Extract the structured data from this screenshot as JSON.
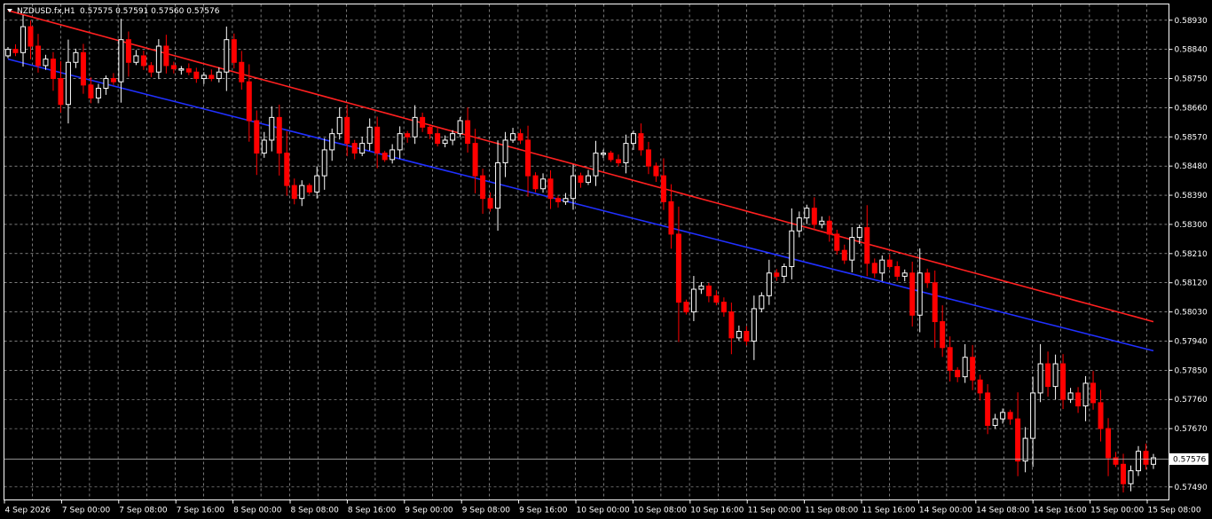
{
  "header": {
    "symbol_tf": "NZDUSD.fx,H1",
    "ohlc": "0.57575 0.57591 0.57560 0.57576"
  },
  "colors": {
    "background": "#000000",
    "grid": "#c8c8c8",
    "frame": "#ffffff",
    "bull_fill": "#000000",
    "bull_stroke": "#ffffff",
    "bear_fill": "#ff0000",
    "ma_slow": "#ff2020",
    "ma_fast": "#2030ff",
    "current_line": "#c0c0c0"
  },
  "chart_data": {
    "type": "candlestick",
    "symbol": "NZDUSD.fx",
    "timeframe": "H1",
    "ylim": [
      0.5745,
      0.5898
    ],
    "y_ticks": [
      "0.58930",
      "0.58840",
      "0.58750",
      "0.58660",
      "0.58570",
      "0.58480",
      "0.58390",
      "0.58300",
      "0.58210",
      "0.58120",
      "0.58030",
      "0.57940",
      "0.57850",
      "0.57760",
      "0.57670",
      "0.57490"
    ],
    "x_ticks": [
      "4 Sep 2026",
      "7 Sep 00:00",
      "7 Sep 08:00",
      "7 Sep 16:00",
      "8 Sep 00:00",
      "8 Sep 08:00",
      "8 Sep 16:00",
      "9 Sep 00:00",
      "9 Sep 08:00",
      "9 Sep 16:00",
      "10 Sep 00:00",
      "10 Sep 08:00",
      "10 Sep 16:00",
      "11 Sep 00:00",
      "11 Sep 08:00",
      "11 Sep 16:00",
      "14 Sep 00:00",
      "14 Sep 08:00",
      "14 Sep 16:00",
      "15 Sep 00:00",
      "15 Sep 08:00"
    ],
    "current_price": "0.57576",
    "close": [
      0.5884,
      0.5883,
      0.5891,
      0.5885,
      0.5879,
      0.5881,
      0.5875,
      0.5867,
      0.588,
      0.5883,
      0.5873,
      0.5869,
      0.5872,
      0.5875,
      0.5874,
      0.5887,
      0.588,
      0.5882,
      0.5879,
      0.5877,
      0.5885,
      0.5879,
      0.5878,
      0.5878,
      0.5877,
      0.5875,
      0.5876,
      0.5875,
      0.5877,
      0.5887,
      0.588,
      0.5874,
      0.5862,
      0.5852,
      0.5856,
      0.5863,
      0.5852,
      0.5842,
      0.5838,
      0.5842,
      0.584,
      0.5845,
      0.5853,
      0.5858,
      0.5863,
      0.5855,
      0.5852,
      0.5855,
      0.586,
      0.5852,
      0.585,
      0.5853,
      0.5858,
      0.5857,
      0.5863,
      0.586,
      0.5858,
      0.5855,
      0.5856,
      0.5858,
      0.5862,
      0.5855,
      0.5845,
      0.5838,
      0.5835,
      0.5849,
      0.5856,
      0.5858,
      0.5856,
      0.5845,
      0.5841,
      0.5844,
      0.5838,
      0.5837,
      0.5838,
      0.5845,
      0.5843,
      0.5845,
      0.5852,
      0.5852,
      0.585,
      0.5849,
      0.5855,
      0.5858,
      0.5853,
      0.5848,
      0.5845,
      0.5837,
      0.5827,
      0.5806,
      0.5803,
      0.581,
      0.5811,
      0.5808,
      0.5806,
      0.5803,
      0.5795,
      0.5797,
      0.5794,
      0.5804,
      0.5808,
      0.5815,
      0.5814,
      0.5817,
      0.5828,
      0.5832,
      0.5835,
      0.583,
      0.5831,
      0.5827,
      0.5822,
      0.5819,
      0.5826,
      0.5829,
      0.5818,
      0.5815,
      0.5819,
      0.5817,
      0.5814,
      0.5815,
      0.5802,
      0.5815,
      0.5812,
      0.58,
      0.5792,
      0.5785,
      0.5783,
      0.5789,
      0.5782,
      0.5778,
      0.5768,
      0.577,
      0.5772,
      0.577,
      0.5757,
      0.5764,
      0.5778,
      0.5787,
      0.578,
      0.5787,
      0.5776,
      0.5778,
      0.5774,
      0.5781,
      0.5775,
      0.5767,
      0.5758,
      0.5756,
      0.575,
      0.5754,
      0.576,
      0.5756,
      0.5758
    ],
    "ma_red": [
      0.5896,
      0.58944,
      0.58928,
      0.58912,
      0.58896,
      0.5888,
      0.58864,
      0.58848,
      0.58832,
      0.58816,
      0.588,
      0.58784,
      0.58768,
      0.58752,
      0.58736,
      0.5872,
      0.58704,
      0.58688,
      0.58672,
      0.58656,
      0.5864,
      0.58624,
      0.58608,
      0.58592,
      0.58576,
      0.5856,
      0.58544,
      0.58528,
      0.58512,
      0.58496,
      0.5848,
      0.58464,
      0.58448,
      0.58432,
      0.58416,
      0.584,
      0.58384,
      0.58368,
      0.58352,
      0.58336,
      0.5832,
      0.58304,
      0.58288,
      0.58272,
      0.58256,
      0.5824,
      0.58224,
      0.58208,
      0.58192,
      0.58176,
      0.5816,
      0.58144,
      0.58128,
      0.58112,
      0.58096,
      0.5808,
      0.58064,
      0.58048,
      0.58032,
      0.58016,
      0.58
    ],
    "ma_blue": [
      0.5881,
      0.58795,
      0.5878,
      0.58765,
      0.5875,
      0.58735,
      0.5872,
      0.58705,
      0.5869,
      0.58675,
      0.5866,
      0.58645,
      0.5863,
      0.58615,
      0.586,
      0.58585,
      0.5857,
      0.58555,
      0.5854,
      0.58525,
      0.5851,
      0.58495,
      0.5848,
      0.58465,
      0.5845,
      0.58435,
      0.5842,
      0.58405,
      0.5839,
      0.58375,
      0.5836,
      0.58345,
      0.5833,
      0.58315,
      0.583,
      0.58285,
      0.5827,
      0.58255,
      0.5824,
      0.58225,
      0.5821,
      0.58195,
      0.5818,
      0.58165,
      0.5815,
      0.58135,
      0.5812,
      0.58105,
      0.5809,
      0.58075,
      0.5806,
      0.58045,
      0.5803,
      0.58015,
      0.58,
      0.57985,
      0.5797,
      0.57955,
      0.5794,
      0.57925,
      0.5791
    ]
  }
}
